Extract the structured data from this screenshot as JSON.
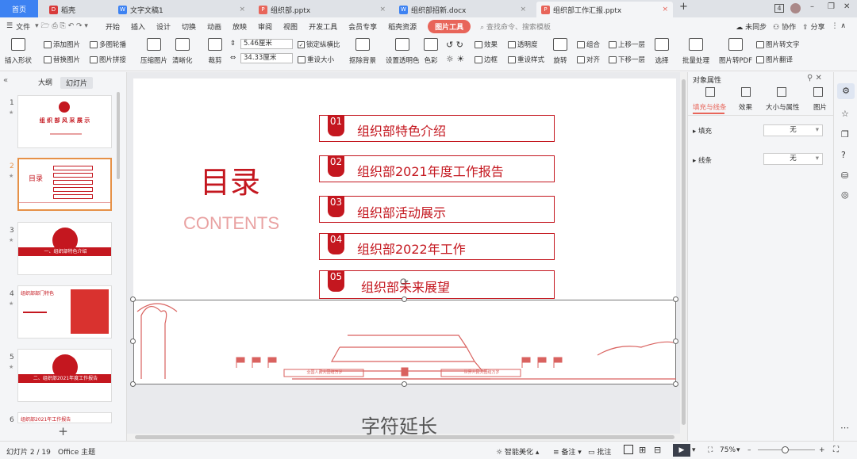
{
  "tabs": {
    "home": "首页",
    "items": [
      {
        "label": "稻壳",
        "color": "#d83a3a",
        "glyph": "D"
      },
      {
        "label": "文字文稿1",
        "color": "#3d82f2",
        "glyph": "W"
      },
      {
        "label": "组织部.pptx",
        "color": "#e8655a",
        "glyph": "P"
      },
      {
        "label": "组织部招新.docx",
        "color": "#3d82f2",
        "glyph": "W"
      },
      {
        "label": "组织部工作汇报.pptx",
        "color": "#e8655a",
        "glyph": "P"
      }
    ],
    "add": "+",
    "close": "×",
    "badge": "4"
  },
  "menubar": {
    "file": "文件",
    "items": [
      "开始",
      "插入",
      "设计",
      "切换",
      "动画",
      "放映",
      "审阅",
      "视图",
      "开发工具",
      "会员专享",
      "稻壳资源"
    ],
    "active": "图片工具",
    "search_placeholder": "查找命令、搜索模板",
    "right": [
      "未同步",
      "协作",
      "分享"
    ]
  },
  "ribbon": {
    "insert_shape": "插入形状",
    "add_picture": "添加图片",
    "replace_picture": "替换图片",
    "multi_outline": "多图轮播",
    "picture_collage": "图片拼接",
    "compress": "压缩图片",
    "clarify": "清晰化",
    "crop": "裁剪",
    "height": "5.46厘米",
    "width": "34.33厘米",
    "lock_ratio": "锁定纵横比",
    "reset_size": "重设大小",
    "remove_bg": "抠除背景",
    "set_transparent": "设置透明色",
    "color": "色彩",
    "effect": "效果",
    "transparency": "透明度",
    "border": "边框",
    "reset_style": "重设样式",
    "rotate": "旋转",
    "group": "组合",
    "align": "对齐",
    "bring_forward": "上移一层",
    "send_backward": "下移一层",
    "select": "选择",
    "batch": "批量处理",
    "to_pdf": "图片转PDF",
    "to_text": "图片转文字",
    "translate": "图片翻译"
  },
  "leftpanel": {
    "tab_outline": "大纲",
    "tab_slides": "幻灯片",
    "thumbs": [
      {
        "num": "1",
        "title": "组 织 部 风 采 展 示"
      },
      {
        "num": "2",
        "title": "目录"
      },
      {
        "num": "3",
        "title": "一、组织部特色介绍"
      },
      {
        "num": "4",
        "title": "组织部部门特色"
      },
      {
        "num": "5",
        "title": "二、组织部2021年度工作报告"
      },
      {
        "num": "6",
        "title": "组织部2021年工作报告"
      }
    ],
    "add": "+"
  },
  "slide": {
    "title": "目录",
    "subtitle": "CONTENTS",
    "items": [
      {
        "num": "01",
        "text": "组织部特色介绍"
      },
      {
        "num": "02",
        "text": "组织部2021年度工作报告"
      },
      {
        "num": "03",
        "text": "组织部活动展示"
      },
      {
        "num": "04",
        "text": "组织部2022年工作"
      },
      {
        "num": "05",
        "text": "组织部未来展望"
      }
    ],
    "banner_left": "全国人民大团结万岁",
    "banner_right": "世界人民大团结万岁"
  },
  "caption": "字符延长",
  "rightpanel": {
    "title": "对象属性",
    "tabs": [
      "填充与线条",
      "效果",
      "大小与属性",
      "图片"
    ],
    "fill_label": "填充",
    "fill_value": "无",
    "line_label": "线条",
    "line_value": "无"
  },
  "statusbar": {
    "slide_info": "幻灯片 2 / 19",
    "theme": "Office 主题",
    "beautify": "智能美化",
    "notes": "备注",
    "comments": "批注",
    "zoom": "75%"
  },
  "colors": {
    "accent": "#c4171f",
    "tool_tab": "#e8655a",
    "selected_thumb": "#e69147"
  }
}
